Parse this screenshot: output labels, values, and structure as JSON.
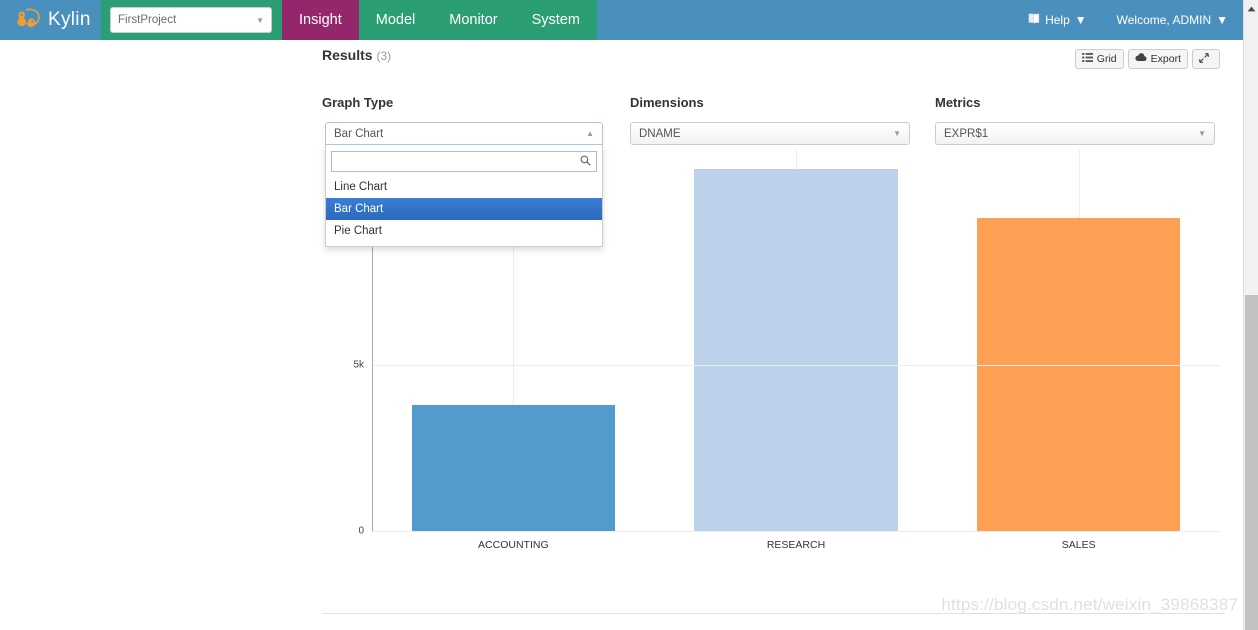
{
  "navbar": {
    "brand": "Kylin",
    "project_selected": "FirstProject",
    "links": [
      {
        "label": "Insight",
        "active": true
      },
      {
        "label": "Model",
        "active": false
      },
      {
        "label": "Monitor",
        "active": false
      },
      {
        "label": "System",
        "active": false
      }
    ],
    "help": "Help",
    "user": "Welcome, ADMIN",
    "colors": {
      "blue": "#4a90bf",
      "green": "#2b9e73",
      "active_magenta": "#94266b"
    }
  },
  "results": {
    "title": "Results",
    "count": "(3)",
    "buttons": {
      "grid": "Grid",
      "export": "Export",
      "expand": ""
    }
  },
  "controls": {
    "graph_type": {
      "label": "Graph Type",
      "selected": "Bar Chart",
      "open": true,
      "search_value": "",
      "search_placeholder": "",
      "options": [
        "Line Chart",
        "Bar Chart",
        "Pie Chart"
      ]
    },
    "dimensions": {
      "label": "Dimensions",
      "selected": "DNAME"
    },
    "metrics": {
      "label": "Metrics",
      "selected": "EXPR$1"
    }
  },
  "chart_data": {
    "type": "bar",
    "title": "",
    "xlabel": "",
    "ylabel": "",
    "categories": [
      "ACCOUNTING",
      "RESEARCH",
      "SALES"
    ],
    "values": [
      3795,
      10930,
      9460
    ],
    "bar_colors": [
      "#539bcd",
      "#bcd2eb",
      "#fda053"
    ],
    "ylim": [
      0,
      11500
    ],
    "yticks": [
      0,
      5000
    ],
    "ytick_labels": [
      "0",
      "5k"
    ],
    "grid": true,
    "legend": "none",
    "series": [
      {
        "name": "EXPR$1",
        "values": [
          3795,
          10930,
          9460
        ]
      }
    ]
  },
  "watermark": "https://blog.csdn.net/weixin_39868387"
}
